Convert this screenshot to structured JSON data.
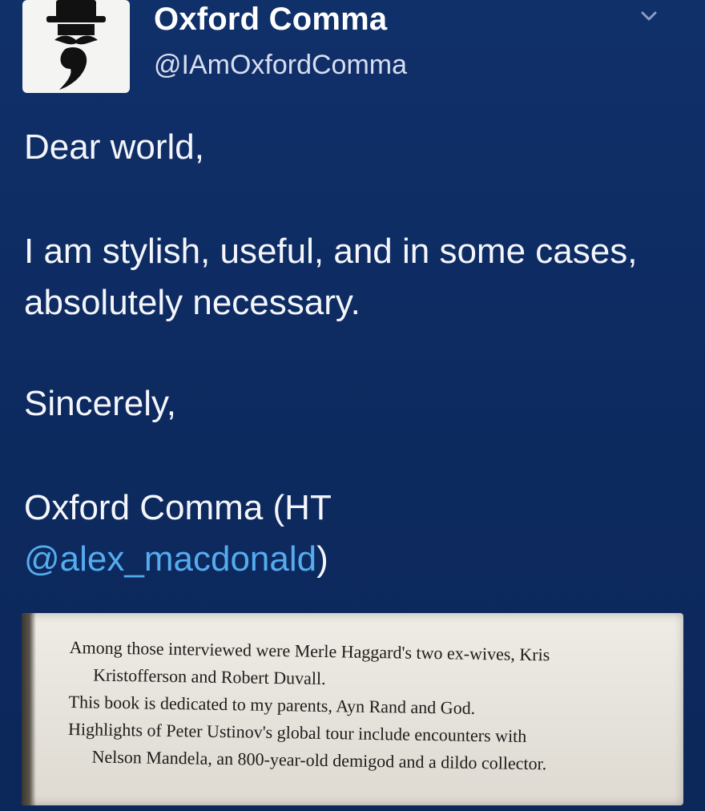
{
  "header": {
    "display_name": "Oxford Comma",
    "handle": "@IAmOxfordComma",
    "avatar_icon": "comma-with-top-hat-and-mustache-icon",
    "menu_icon": "chevron-down-icon"
  },
  "tweet": {
    "greeting": "Dear world,",
    "main": "I am stylish, useful, and in some cases, absolutely necessary.",
    "closing": "Sincerely,",
    "signoff_prefix": "Oxford Comma (HT ",
    "mention": "@alex_macdonald",
    "signoff_suffix": ")"
  },
  "book_excerpt": {
    "lines": [
      "Among those interviewed were Merle Haggard's two ex-wives, Kris",
      "Kristofferson and Robert Duvall.",
      "This book is dedicated to my parents, Ayn Rand and God.",
      "Highlights of Peter Ustinov's global tour include encounters with",
      "Nelson Mandela, an 800-year-old demigod and a dildo collector."
    ]
  },
  "colors": {
    "background": "#0e2a5c",
    "text": "#f4f6fb",
    "mention": "#55acee",
    "handle": "#d8def0"
  }
}
